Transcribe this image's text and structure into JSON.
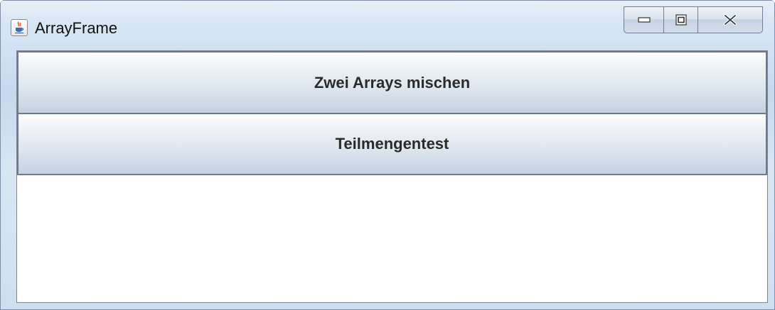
{
  "window": {
    "title": "ArrayFrame",
    "icon": "java-coffee-cup-icon"
  },
  "caption_buttons": {
    "minimize_icon": "minimize-icon",
    "maximize_icon": "maximize-icon",
    "close_icon": "close-icon"
  },
  "buttons": {
    "merge_arrays_label": "Zwei Arrays mischen",
    "subset_test_label": "Teilmengentest"
  }
}
